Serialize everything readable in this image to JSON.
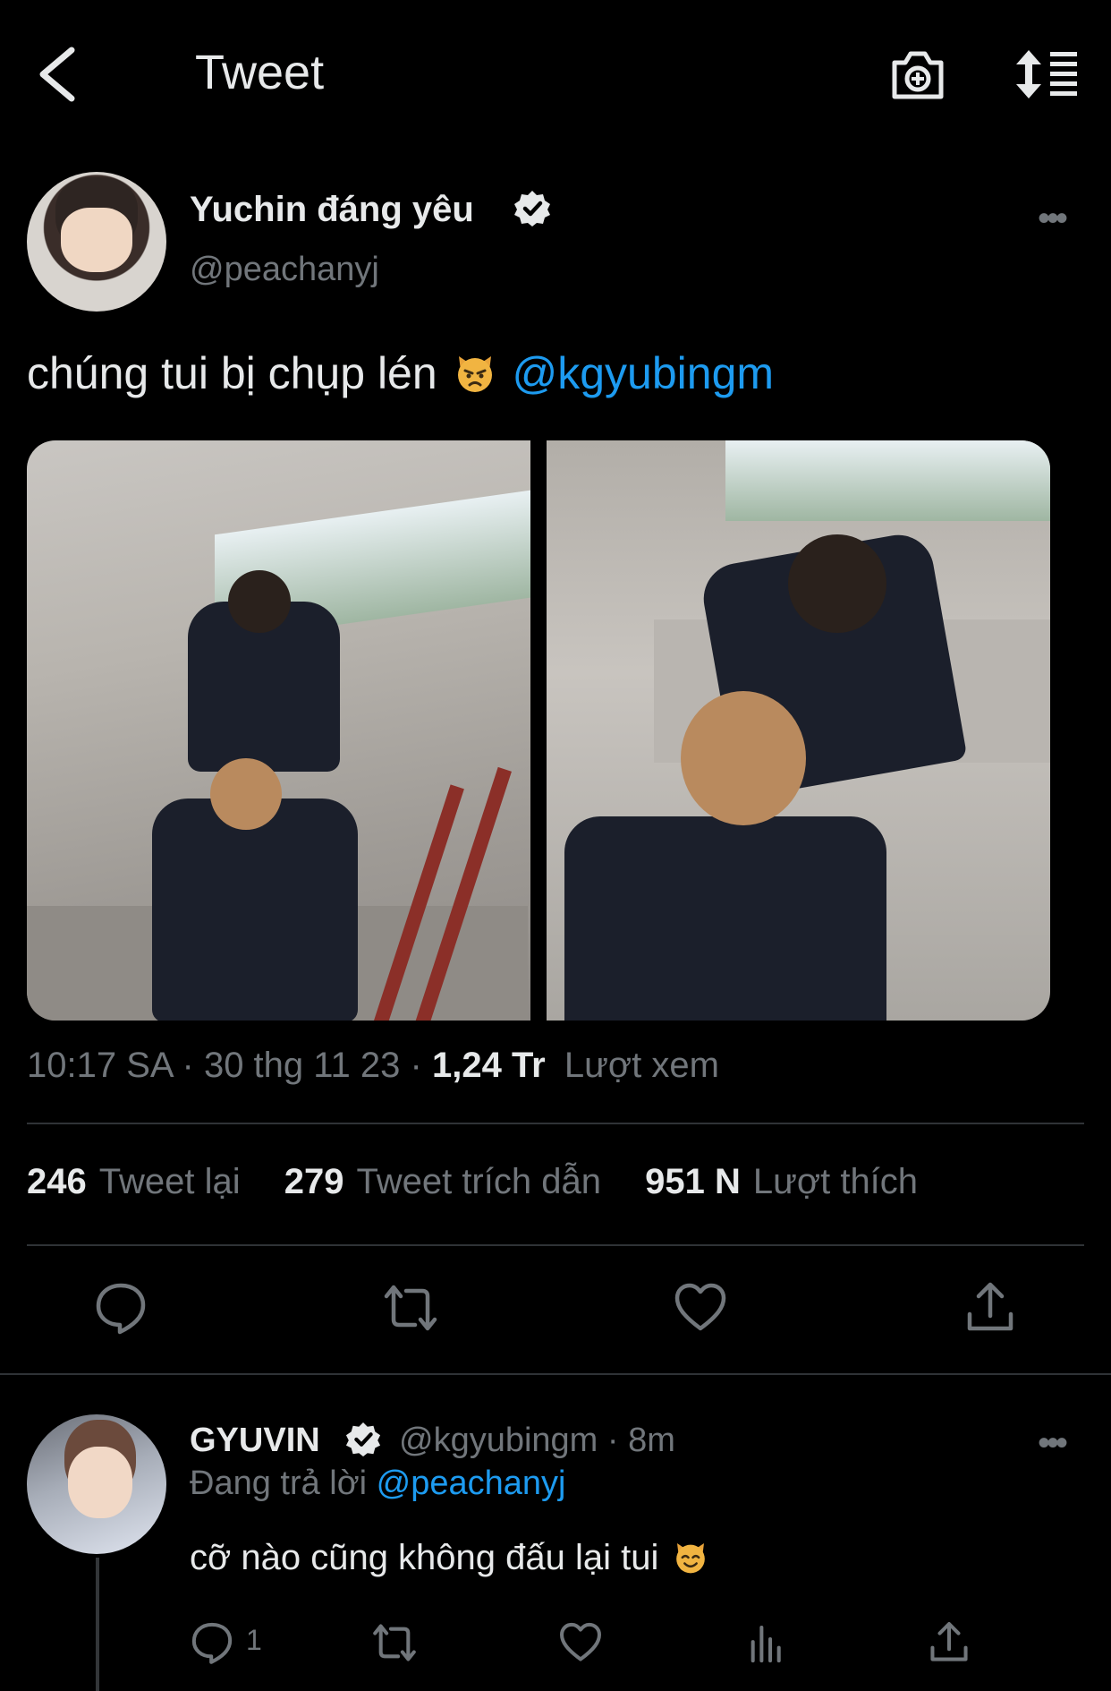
{
  "header": {
    "title": "Tweet",
    "back_icon": "chevron-left-icon",
    "camera_icon": "camera-plus-icon",
    "sort_icon": "sort-icon"
  },
  "tweet": {
    "author_name": "Yuchin đáng yêu",
    "author_handle": "@peachanyj",
    "text_before": "chúng tui bị chụp lén",
    "text_emoji": "pouting-cat-emoji",
    "mention": "@kgyubingm",
    "time": "10:17 SA",
    "separator": "·",
    "date": "30 thg 11 23",
    "views_count": "1,24 Tr",
    "views_label": "Lượt xem",
    "retweets_count": "246",
    "retweets_label": "Tweet lại",
    "quotes_count": "279",
    "quotes_label": "Tweet trích dẫn",
    "likes_count": "951 N",
    "likes_label": "Lượt thích",
    "photos": [
      "photo-stairs-1",
      "photo-stairs-2"
    ]
  },
  "reply": {
    "author_name": "GYUVIN",
    "author_handle": "@kgyubingm",
    "separator": "·",
    "time": "8m",
    "replying_label": "Đang trả lời",
    "replying_to": "@peachanyj",
    "text": "cỡ nào cũng không đấu lại tui",
    "text_emoji": "smiling-cat-with-horns-emoji",
    "reply_count": "1"
  },
  "colors": {
    "background": "#000000",
    "text_primary": "#e7e9ea",
    "text_secondary": "#71767b",
    "accent": "#1d9bf0",
    "divider": "#2f3336"
  }
}
